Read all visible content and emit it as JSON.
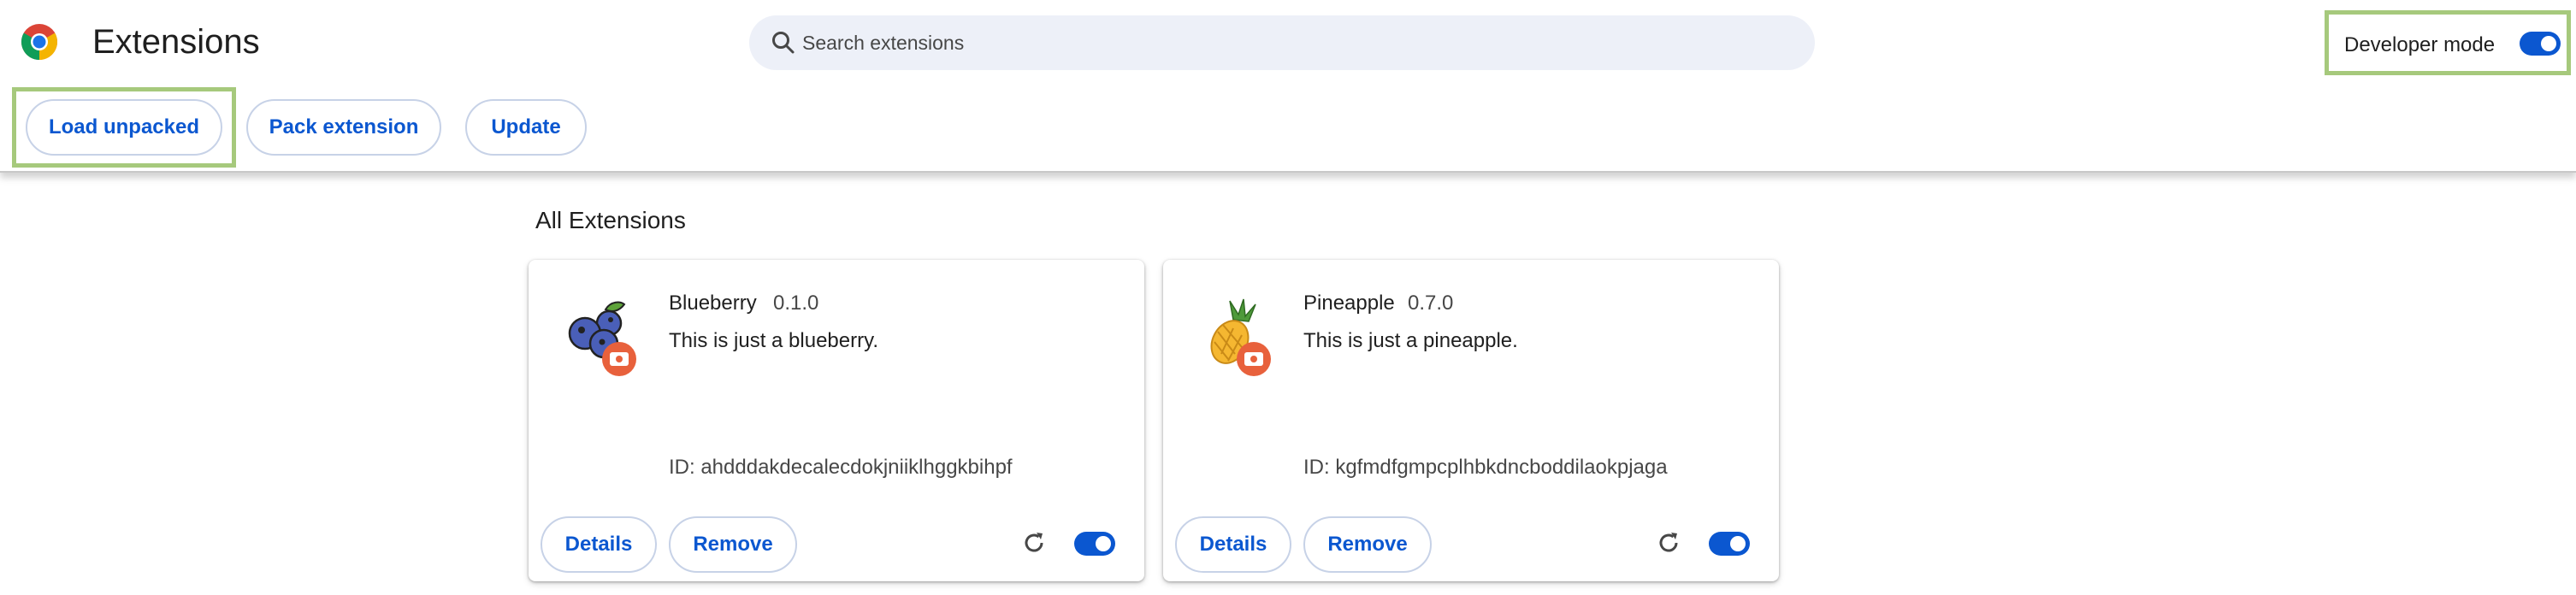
{
  "header": {
    "title": "Extensions",
    "search_placeholder": "Search extensions",
    "developer_mode_label": "Developer mode",
    "developer_mode_on": true
  },
  "toolbar": {
    "load_unpacked": "Load unpacked",
    "pack_extension": "Pack extension",
    "update": "Update"
  },
  "section": {
    "title": "All Extensions"
  },
  "extensions": [
    {
      "name": "Blueberry",
      "version": "0.1.0",
      "description": "This is just a blueberry.",
      "id_text": "ID: ahdddakdecalecdokjniiklhggkbihpf",
      "details_label": "Details",
      "remove_label": "Remove",
      "enabled": true
    },
    {
      "name": "Pineapple",
      "version": "0.7.0",
      "description": "This is just a pineapple.",
      "id_text": "ID: kgfmdfgmpcplhbkdncboddilaokpjaga",
      "details_label": "Details",
      "remove_label": "Remove",
      "enabled": true
    }
  ],
  "colors": {
    "accent": "#0b57d0",
    "highlight": "#a6c97c",
    "search_bg": "#edf0f8",
    "badge": "#e8613c"
  }
}
